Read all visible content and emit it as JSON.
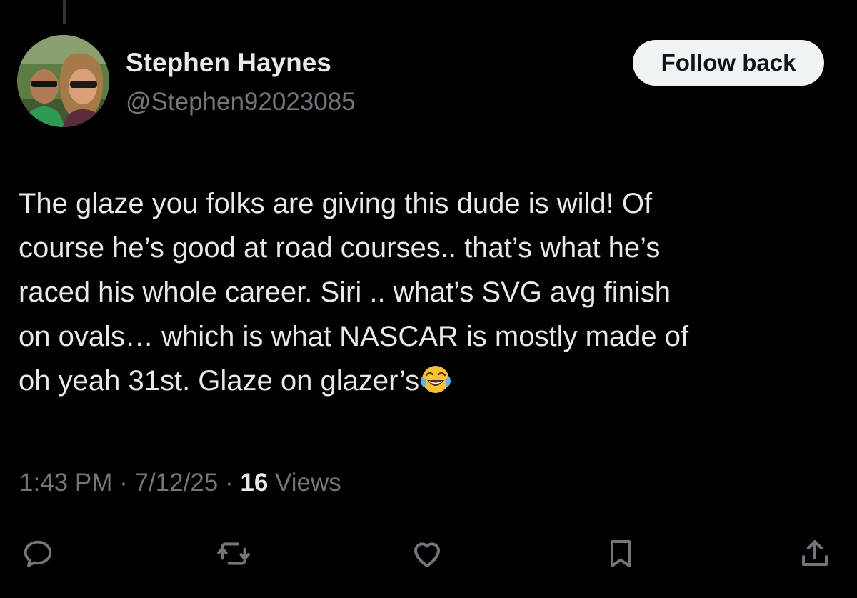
{
  "author": {
    "display_name": "Stephen Haynes",
    "handle": "@Stephen92023085",
    "avatar_alt": "profile photo"
  },
  "header": {
    "follow_label": "Follow back"
  },
  "tweet": {
    "lines": [
      "The glaze you folks are giving this dude is wild! Of",
      "course he’s good at road courses.. that’s what he’s",
      "raced his whole career. Siri .. what’s SVG avg finish",
      "on ovals… which is what NASCAR is mostly made of",
      "oh yeah 31st. Glaze on glazer’s"
    ],
    "emoji": "face-with-tears-of-joy"
  },
  "meta": {
    "time": "1:43 PM",
    "separator": " · ",
    "date": "7/12/25",
    "views_count": "16",
    "views_label": " Views"
  },
  "actions": {
    "reply_icon": "reply-icon",
    "repost_icon": "repost-icon",
    "like_icon": "heart-icon",
    "bookmark_icon": "bookmark-icon",
    "share_icon": "share-icon"
  },
  "colors": {
    "background": "#000000",
    "primary_text": "#e7e9ea",
    "secondary_text": "#71767b",
    "button_bg": "#eff3f4",
    "button_text": "#0f1419"
  }
}
